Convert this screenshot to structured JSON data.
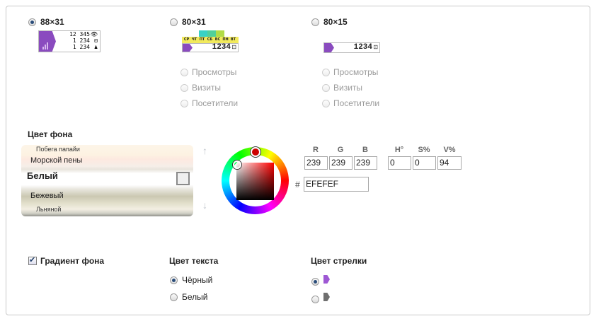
{
  "sizes": {
    "s88": {
      "label": "88×31",
      "selected": true,
      "lines": [
        "12 345",
        "1 234",
        "1 234"
      ]
    },
    "s80": {
      "label": "80×31",
      "selected": false,
      "days": [
        "СР",
        "ЧТ",
        "ПТ",
        "СБ",
        "ВС",
        "ПН",
        "ВТ"
      ],
      "value": "1234"
    },
    "s15": {
      "label": "80×15",
      "selected": false,
      "value": "1234"
    }
  },
  "metrics": [
    "Просмотры",
    "Визиты",
    "Посетители"
  ],
  "background": {
    "title": "Цвет фона",
    "colors": [
      "Побега папайи",
      "Морской пены",
      "Белый",
      "Бежевый",
      "Льняной"
    ],
    "selected": "Белый"
  },
  "picker": {
    "headers": {
      "r": "R",
      "g": "G",
      "b": "B",
      "h": "H°",
      "s": "S%",
      "v": "V%"
    },
    "values": {
      "r": "239",
      "g": "239",
      "b": "239",
      "h": "0",
      "s": "0",
      "v": "94"
    },
    "hash": "#",
    "hex": "EFEFEF",
    "hue_color": "#cc0000"
  },
  "gradient": {
    "label": "Градиент фона",
    "checked": true
  },
  "text_color": {
    "title": "Цвет текста",
    "options": [
      "Чёрный",
      "Белый"
    ],
    "selected": "Чёрный"
  },
  "arrow_color": {
    "title": "Цвет стрелки",
    "options": [
      "purple",
      "gray"
    ],
    "selected": "purple"
  },
  "colors": {
    "accent": "#8a4bbf",
    "panel_border": "#c8c8c8",
    "disabled_text": "#9b9b9b"
  }
}
